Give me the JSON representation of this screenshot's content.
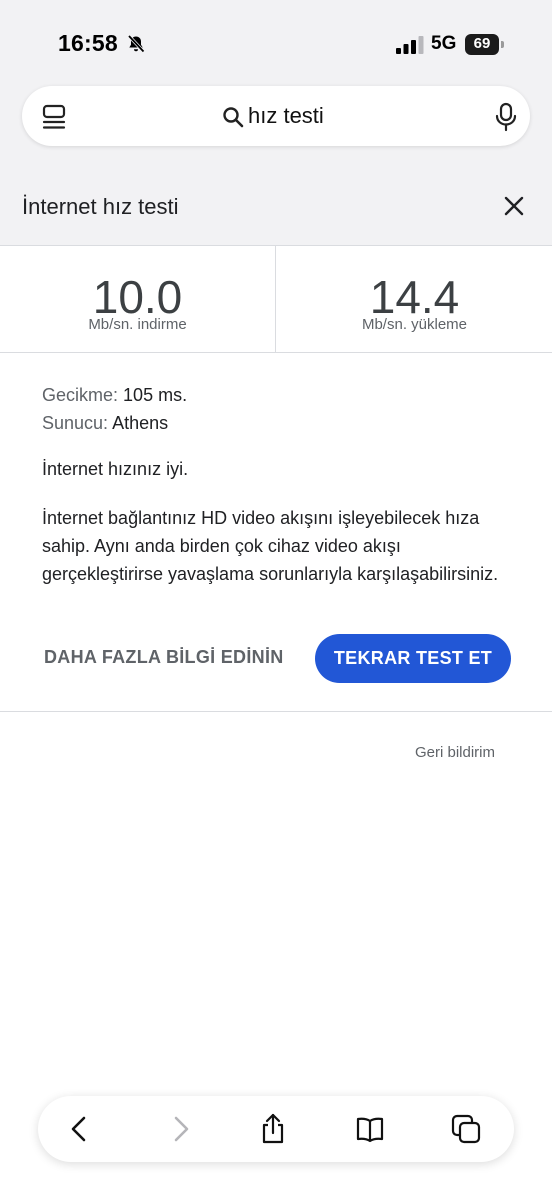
{
  "status_bar": {
    "time": "16:58",
    "network": "5G",
    "battery": "69"
  },
  "search": {
    "query": "hız testi"
  },
  "header": {
    "title": "İnternet hız testi"
  },
  "results": {
    "download": {
      "value": "10.0",
      "label": "Mb/sn. indirme"
    },
    "upload": {
      "value": "14.4",
      "label": "Mb/sn. yükleme"
    },
    "latency_label": "Gecikme:",
    "latency_value": "105 ms.",
    "server_label": "Sunucu:",
    "server_value": "Athens",
    "summary": "İnternet hızınız iyi.",
    "description": "İnternet bağlantınız HD video akışını işleyebilecek hıza sahip. Aynı anda birden çok cihaz video akışı gerçekleştirirse yavaşlama sorunlarıyla karşılaşabilirsiniz.",
    "more_info_label": "DAHA FAZLA BİLGİ EDİNİN",
    "retest_label": "TEKRAR TEST ET"
  },
  "feedback_label": "Geri bildirim",
  "colors": {
    "accent": "#2257d6",
    "top_background": "#f2f2f4"
  }
}
